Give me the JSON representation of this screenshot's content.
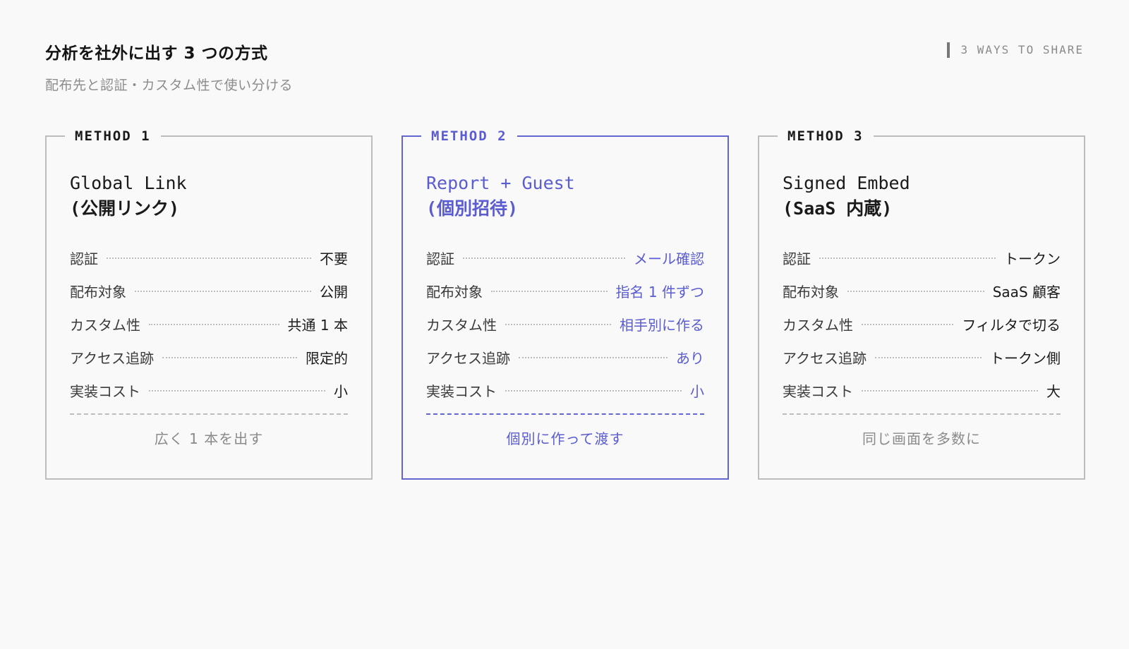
{
  "header": {
    "title": "分析を社外に出す 3 つの方式",
    "subtitle": "配布先と認証・カスタム性で使い分ける",
    "tag": "3 WAYS TO SHARE"
  },
  "colors": {
    "accent": "#5a5cd0",
    "border": "#bdbdbd",
    "muted": "#8a8a8a",
    "background": "#f9f9fa"
  },
  "cards": [
    {
      "legend": "METHOD 1",
      "title_line1": "Global Link",
      "title_line2": "(公開リンク)",
      "rows": [
        {
          "key": "認証",
          "value": "不要"
        },
        {
          "key": "配布対象",
          "value": "公開"
        },
        {
          "key": "カスタム性",
          "value": "共通 1 本"
        },
        {
          "key": "アクセス追跡",
          "value": "限定的"
        },
        {
          "key": "実装コスト",
          "value": "小"
        }
      ],
      "footer": "広く 1 本を出す"
    },
    {
      "legend": "METHOD 2",
      "title_line1": "Report + Guest",
      "title_line2": "(個別招待)",
      "highlighted": true,
      "rows": [
        {
          "key": "認証",
          "value": "メール確認"
        },
        {
          "key": "配布対象",
          "value": "指名 1 件ずつ"
        },
        {
          "key": "カスタム性",
          "value": "相手別に作る"
        },
        {
          "key": "アクセス追跡",
          "value": "あり"
        },
        {
          "key": "実装コスト",
          "value": "小"
        }
      ],
      "footer": "個別に作って渡す"
    },
    {
      "legend": "METHOD 3",
      "title_line1": "Signed Embed",
      "title_line2": "(SaaS 内蔵)",
      "rows": [
        {
          "key": "認証",
          "value": "トークン"
        },
        {
          "key": "配布対象",
          "value": "SaaS 顧客"
        },
        {
          "key": "カスタム性",
          "value": "フィルタで切る"
        },
        {
          "key": "アクセス追跡",
          "value": "トークン側"
        },
        {
          "key": "実装コスト",
          "value": "大"
        }
      ],
      "footer": "同じ画面を多数に"
    }
  ]
}
